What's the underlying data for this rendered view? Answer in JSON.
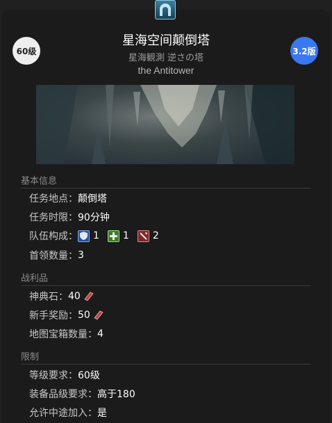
{
  "header": {
    "level_badge": "60级",
    "version_badge": "3.2版",
    "title": "星海空间颠倒塔",
    "subtitle_jp": "星海観測 逆さの塔",
    "subtitle_en": "the Antitower"
  },
  "sections": {
    "basic": "基本信息",
    "loot": "战利品",
    "limits": "限制"
  },
  "basic": {
    "location_label": "任务地点：",
    "location_value": "颠倒塔",
    "time_label": "任务时限：",
    "time_value": "90分钟",
    "party_label": "队伍构成：",
    "tanks": "1",
    "healers": "1",
    "dps": "2",
    "boss_label": "首领数量：",
    "boss_value": "3"
  },
  "loot": {
    "tome_label": "神典石：",
    "tome_value": "40",
    "rookie_label": "新手奖励：",
    "rookie_value": "50",
    "chest_label": "地图宝箱数量：",
    "chest_value": "4"
  },
  "limits": {
    "level_label": "等级要求：",
    "level_value": "60级",
    "ilvl_label": "装备品级要求：",
    "ilvl_value": "高于180",
    "join_label": "允许中途加入：",
    "join_value": "是"
  },
  "colors": {
    "version_badge": "#3a78f2",
    "level_badge": "#eeeeee",
    "card": "#1b1b1b"
  }
}
